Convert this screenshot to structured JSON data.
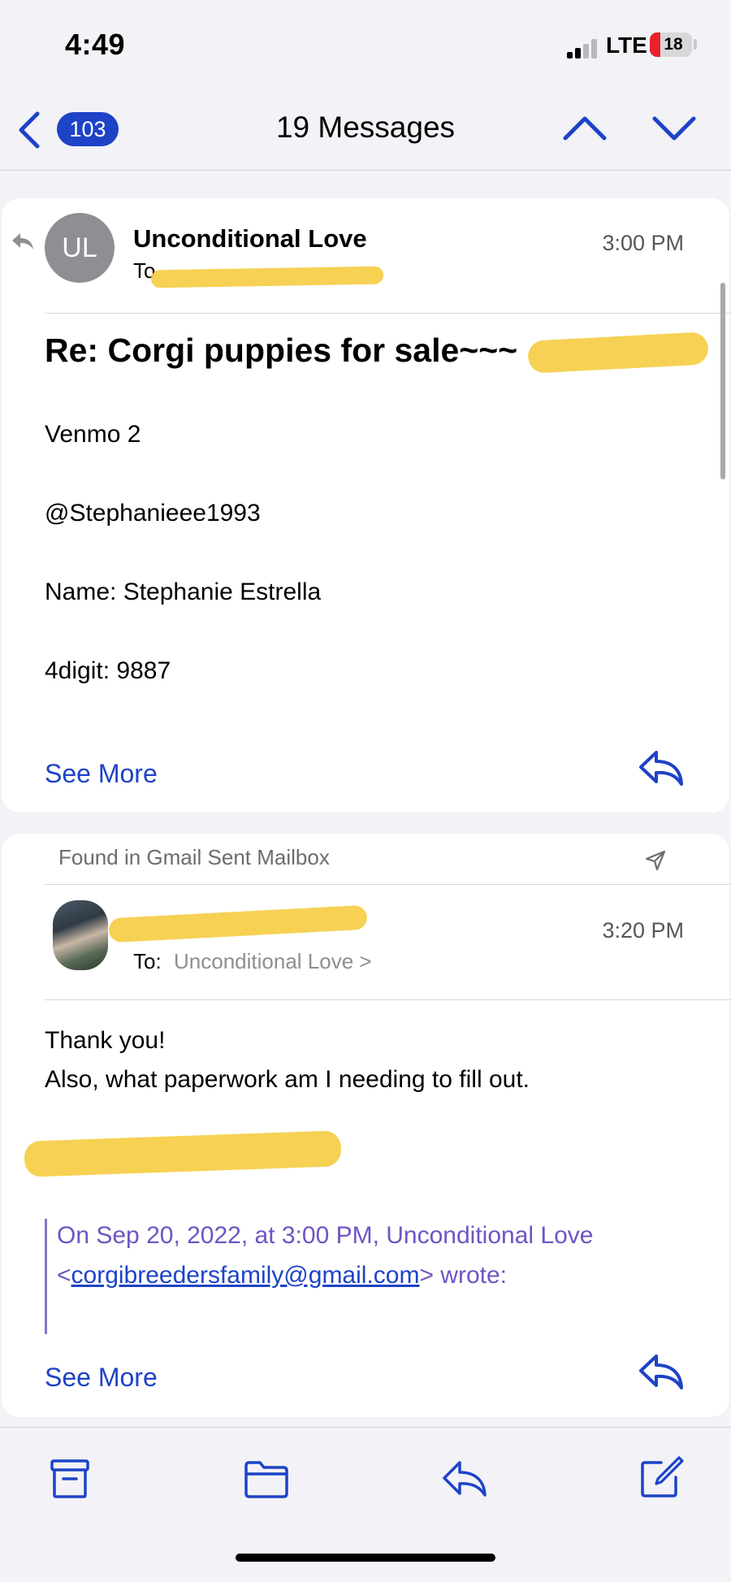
{
  "status_bar": {
    "time": "4:49",
    "network": "LTE",
    "battery": "18"
  },
  "nav": {
    "badge_count": "103",
    "title": "19 Messages"
  },
  "message1": {
    "avatar_initials": "UL",
    "sender": "Unconditional Love",
    "to_prefix": "To",
    "time": "3:00 PM",
    "subject": "Re: Corgi puppies for sale~~~",
    "body": [
      "Venmo 2",
      "@Stephanieee1993",
      "Name: Stephanie Estrella",
      "4digit: 9887"
    ],
    "see_more": "See More"
  },
  "message2": {
    "found_in": "Found in Gmail Sent Mailbox",
    "to_label": "To:",
    "to_name": "Unconditional Love >",
    "time": "3:20 PM",
    "body": [
      "Thank you!",
      "Also, what paperwork am I needing to fill out."
    ],
    "quote_line1": "On Sep 20, 2022, at 3:00 PM, Unconditional Love",
    "quote_email": "corgibreedersfamily@gmail.com",
    "quote_lt": "<",
    "quote_suffix": "> wrote:",
    "see_more": "See More"
  },
  "toolbar": {
    "items": [
      "archive-icon",
      "folder-icon",
      "reply-icon",
      "compose-icon"
    ]
  },
  "colors": {
    "accent": "#1d43c6",
    "quote": "#6f55c3",
    "redaction": "#f5cf4a"
  }
}
